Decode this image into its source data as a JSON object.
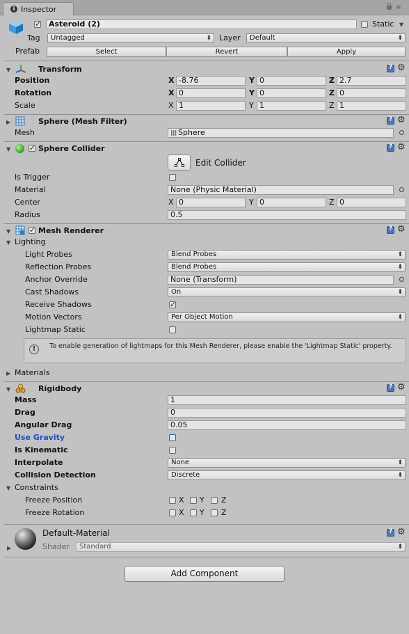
{
  "tab": {
    "label": "Inspector"
  },
  "object": {
    "name": "Asteroid (2)",
    "static_label": "Static",
    "tag_label": "Tag",
    "tag_value": "Untagged",
    "layer_label": "Layer",
    "layer_value": "Default",
    "prefab_label": "Prefab",
    "prefab_buttons": [
      "Select",
      "Revert",
      "Apply"
    ]
  },
  "transform": {
    "title": "Transform",
    "rows": [
      {
        "label": "Position",
        "x": "-8.76",
        "y": "0",
        "z": "2.7"
      },
      {
        "label": "Rotation",
        "x": "0",
        "y": "0",
        "z": "0"
      },
      {
        "label": "Scale",
        "x": "1",
        "y": "1",
        "z": "1"
      }
    ],
    "axes": [
      "X",
      "Y",
      "Z"
    ]
  },
  "mesh_filter": {
    "title": "Sphere (Mesh Filter)",
    "mesh_label": "Mesh",
    "mesh_value": "Sphere"
  },
  "sphere_collider": {
    "title": "Sphere Collider",
    "edit_label": "Edit Collider",
    "is_trigger_label": "Is Trigger",
    "material_label": "Material",
    "material_value": "None (Physic Material)",
    "center_label": "Center",
    "center": {
      "x": "0",
      "y": "0",
      "z": "0"
    },
    "radius_label": "Radius",
    "radius_value": "0.5"
  },
  "mesh_renderer": {
    "title": "Mesh Renderer",
    "lighting_label": "Lighting",
    "light_probes_label": "Light Probes",
    "light_probes_value": "Blend Probes",
    "reflection_probes_label": "Reflection Probes",
    "reflection_probes_value": "Blend Probes",
    "anchor_override_label": "Anchor Override",
    "anchor_override_value": "None (Transform)",
    "cast_shadows_label": "Cast Shadows",
    "cast_shadows_value": "On",
    "receive_shadows_label": "Receive Shadows",
    "motion_vectors_label": "Motion Vectors",
    "motion_vectors_value": "Per Object Motion",
    "lightmap_static_label": "Lightmap Static",
    "help_text": "To enable generation of lightmaps for this Mesh Renderer, please enable the 'Lightmap Static' property.",
    "materials_label": "Materials"
  },
  "rigidbody": {
    "title": "Rigidbody",
    "mass_label": "Mass",
    "mass_value": "1",
    "drag_label": "Drag",
    "drag_value": "0",
    "angular_drag_label": "Angular Drag",
    "angular_drag_value": "0.05",
    "use_gravity_label": "Use Gravity",
    "is_kinematic_label": "Is Kinematic",
    "interpolate_label": "Interpolate",
    "interpolate_value": "None",
    "collision_label": "Collision Detection",
    "collision_value": "Discrete",
    "constraints_label": "Constraints",
    "freeze_position_label": "Freeze Position",
    "freeze_rotation_label": "Freeze Rotation"
  },
  "material": {
    "name": "Default-Material",
    "shader_label": "Shader",
    "shader_value": "Standard"
  },
  "add_component_label": "Add Component"
}
